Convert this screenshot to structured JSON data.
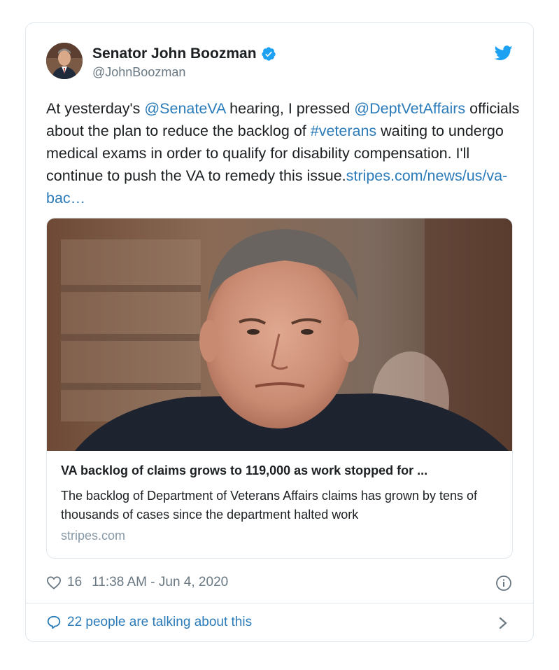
{
  "author": {
    "name": "Senator John Boozman",
    "handle": "@JohnBoozman",
    "verified": true,
    "avatar_icon": "avatar-portrait"
  },
  "tweet": {
    "text_before_1": "At yesterday's ",
    "mention_1": "@SenateVA",
    "text_before_2": " hearing, I pressed ",
    "mention_2": "@DeptVetAffairs",
    "text_before_3": " officials about the plan to reduce the backlog of ",
    "hashtag": "#veterans",
    "text_before_4": " waiting to undergo medical exams in order to qualify for disability compensation. I'll continue to push the VA to remedy this issue.",
    "link": "stripes.com/news/us/va-bac…"
  },
  "card": {
    "title": "VA backlog of claims grows to 119,000 as work stopped for ...",
    "description": "The backlog of Department of Veterans Affairs claims has grown by tens of thousands of cases since the department halted work",
    "domain": "stripes.com"
  },
  "meta": {
    "likes": "16",
    "timestamp": "11:38 AM - Jun 4, 2020"
  },
  "footer": {
    "talking": "22 people are talking about this"
  },
  "colors": {
    "link": "#2b7bb9",
    "verified": "#1da1f2",
    "twitter_bird": "#1da1f2",
    "secondary_text": "#697882",
    "border": "#e1e8ed"
  },
  "icons": [
    "avatar-portrait",
    "verified-badge-icon",
    "twitter-bird-icon",
    "heart-icon",
    "info-icon",
    "speech-bubble-icon",
    "chevron-right-icon"
  ]
}
